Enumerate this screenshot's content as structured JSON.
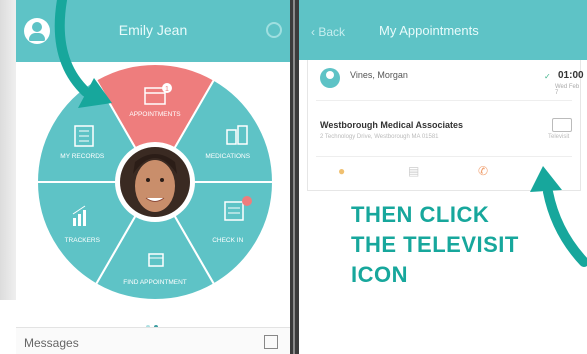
{
  "left_screen": {
    "header": {
      "title": "Emily Jean"
    },
    "wheel": {
      "segments": [
        {
          "label": "APPOINTMENTS",
          "color": "#ee7d7d"
        },
        {
          "label": "MEDICATIONS",
          "color": "#5ec3c6"
        },
        {
          "label": "CHECK IN",
          "color": "#5ec3c6",
          "badge": "1"
        },
        {
          "label": "FIND APPOINTMENT",
          "color": "#5ec3c6"
        },
        {
          "label": "TRACKERS",
          "color": "#5ec3c6"
        },
        {
          "label": "MY RECORDS",
          "color": "#5ec3c6"
        }
      ],
      "appointments_badge": "1"
    },
    "page_dots": {
      "count": 2,
      "active": 1
    },
    "messages_label": "Messages"
  },
  "right_screen": {
    "header": {
      "back_label": "‹ Back",
      "title": "My Appointments"
    },
    "appointment": {
      "doctor": "Vines, Morgan",
      "time": "01:00 PM",
      "date": "Wed Feb 7",
      "practice": "Westborough Medical Associates",
      "address": "2 Technology Drive, Westborough MA 01581",
      "televisit_label": "Televisit"
    },
    "instruction_lines": [
      "THEN CLICK",
      "THE TELEVISIT",
      "ICON"
    ]
  },
  "colors": {
    "teal": "#5ec3c6",
    "coral": "#ee7d7d",
    "arrow_green": "#17a79c"
  }
}
